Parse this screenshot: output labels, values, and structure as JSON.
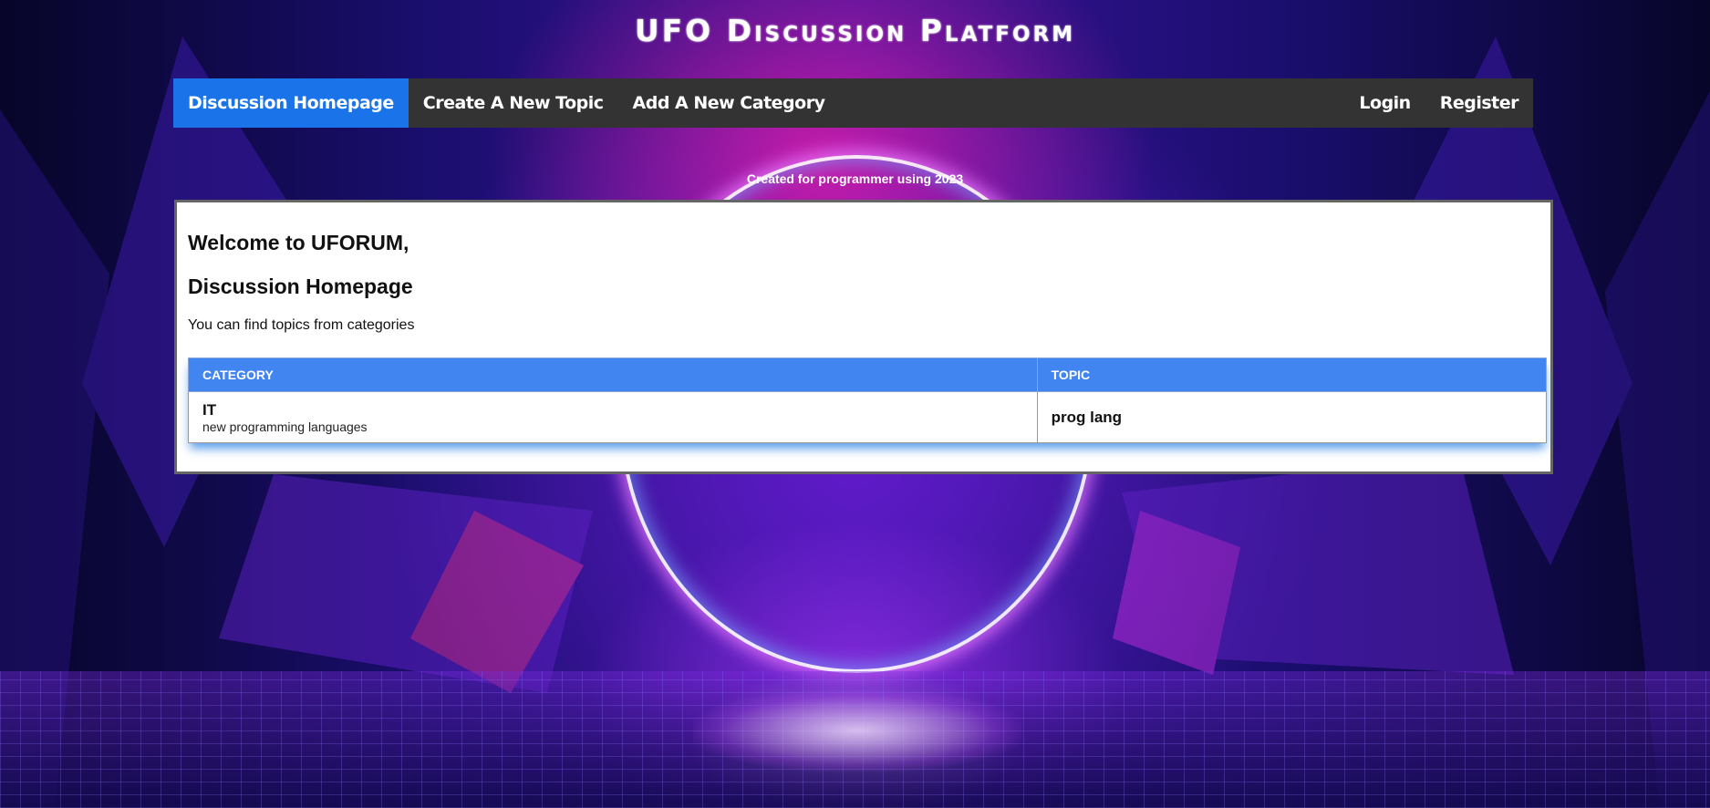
{
  "site": {
    "title": "UFO Discussion Platform",
    "tagline": "Created for programmer using 2023"
  },
  "nav": {
    "left": [
      {
        "label": "Discussion Homepage",
        "active": true
      },
      {
        "label": "Create A New Topic",
        "active": false
      },
      {
        "label": "Add A New Category",
        "active": false
      }
    ],
    "right": [
      {
        "label": "Login"
      },
      {
        "label": "Register"
      }
    ]
  },
  "main": {
    "welcome": "Welcome to UFORUM,",
    "heading": "Discussion Homepage",
    "description": "You can find topics from categories",
    "table": {
      "headers": [
        "Category",
        "Topic"
      ],
      "rows": [
        {
          "category": "IT",
          "category_desc": "new programming languages",
          "topic": "prog lang"
        }
      ]
    }
  },
  "colors": {
    "navbar": "#333333",
    "nav_active": "#1a73e8",
    "table_header": "#4185f0"
  }
}
